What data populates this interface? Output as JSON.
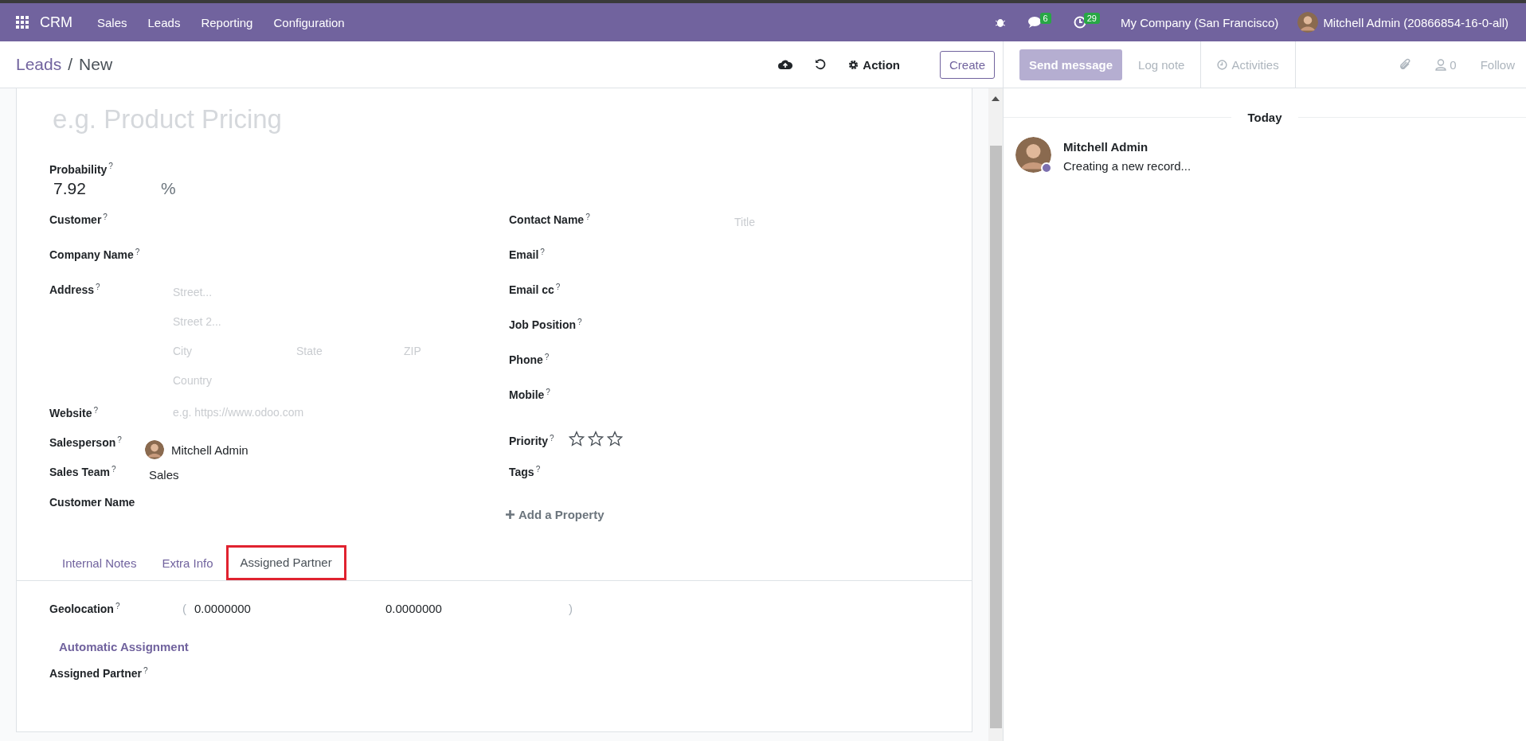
{
  "navbar": {
    "app_name": "CRM",
    "menu": [
      "Sales",
      "Leads",
      "Reporting",
      "Configuration"
    ],
    "messages_count": "6",
    "activities_count": "29",
    "company": "My Company (San Francisco)",
    "user": "Mitchell Admin (20866854-16-0-all)"
  },
  "breadcrumb": {
    "items": [
      "Leads",
      "New"
    ],
    "separator": "/"
  },
  "control_panel": {
    "action": "Action",
    "create": "Create"
  },
  "form": {
    "title_placeholder": "e.g. Product Pricing",
    "probability": {
      "label": "Probability$^{?}$",
      "value": "7.92",
      "unit": "%"
    },
    "left_fields": [
      {
        "kind": "plain",
        "label": "Customer$^{?}$"
      },
      {
        "kind": "plain",
        "label": "Company Name$^{?}$"
      },
      {
        "kind": "address",
        "label": "Address$^{?}$",
        "street": "Street...",
        "street2": "Street 2...",
        "city": "City",
        "state": "State",
        "zip": "ZIP",
        "country": "Country"
      },
      {
        "kind": "placeholder",
        "label": "Website$^{?}$",
        "placeholder": "e.g. https://www.odoo.com"
      },
      {
        "kind": "user",
        "label": "Salesperson$^{?}$",
        "value": "Mitchell Admin"
      },
      {
        "kind": "value",
        "label": "Sales Team$^{?}$",
        "value": "Sales"
      },
      {
        "kind": "plain",
        "label": "Customer Name"
      }
    ],
    "right_fields": [
      {
        "kind": "contact",
        "label": "Contact Name$^{?}$",
        "placeholder": "Title"
      },
      {
        "kind": "plain",
        "label": "Email$^{?}$"
      },
      {
        "kind": "plain",
        "label": "Email cc$^{?}$"
      },
      {
        "kind": "plain",
        "label": "Job Position$^{?}$"
      },
      {
        "kind": "plain",
        "label": "Phone$^{?}$"
      },
      {
        "kind": "plain",
        "label": "Mobile$^{?}$"
      },
      {
        "kind": "priority",
        "label": "Priority$^{?}$",
        "stars": 0
      },
      {
        "kind": "plain",
        "label": "Tags$^{?}$"
      }
    ],
    "add_property": "Add a Property",
    "tabs": [
      {
        "label": "Internal Notes",
        "selected": false,
        "highlighted": false
      },
      {
        "label": "Extra Info",
        "selected": false,
        "highlighted": false
      },
      {
        "label": "Assigned Partner",
        "selected": true,
        "highlighted": true
      }
    ],
    "geolocation": {
      "label": "Geolocation$^{?}$",
      "open": "(",
      "latitude": "0.0000000",
      "longitude": "0.0000000",
      "close": ")"
    },
    "section_title": "Automatic Assignment",
    "assigned_partner": {
      "label": "Assigned Partner$^{?}$"
    }
  },
  "chatter": {
    "send_message": "Send message",
    "log_note": "Log note",
    "activities": "Activities",
    "followers_count": "0",
    "follow": "Follow",
    "date": "Today",
    "messages": [
      {
        "author": "Mitchell Admin",
        "body": "Creating a new record..."
      }
    ]
  }
}
